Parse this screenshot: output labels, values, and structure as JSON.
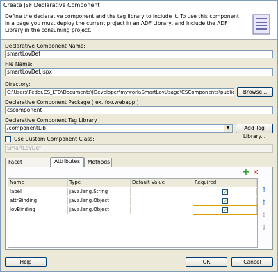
{
  "window": {
    "title": "Create JSF Declarative Component"
  },
  "banner": {
    "text": "Define the declarative component and the tag library to include it.  To use this component in a page you must deploy the current project in an ADF Library, and include the ADF Library in the consuming project."
  },
  "form": {
    "component_name_label": "Declarative Component Name:",
    "component_name_value": "smartLovDef",
    "file_name_label": "File Name:",
    "file_name_value": "smartLovDef.jspx",
    "directory_label": "Directory:",
    "directory_value": "C:\\Users\\Fedor.CS_LTD\\Documents\\JDeveloper\\mywork\\SmartLovUsage\\CSComponents\\public_html",
    "browse_label": "Browse...",
    "package_label": "Declarative Component Package ( ex. foo.webapp )",
    "package_value": "cscomponent",
    "taglib_label": "Declarative Component Tag Library",
    "taglib_value": "/componentLib",
    "add_taglib_label": "Add Tag Library...",
    "custom_class_label": "Use Custom Component Class:",
    "custom_class_value": "SmartLovDef"
  },
  "tabs": [
    "Facet Definitions",
    "Attributes",
    "Methods"
  ],
  "table": {
    "headers": [
      "Name",
      "Type",
      "Default Value",
      "Required"
    ],
    "rows": [
      {
        "name": "label",
        "type": "java.lang.String",
        "default": "",
        "required": true
      },
      {
        "name": "attrBinding",
        "type": "java.lang.Object",
        "default": "",
        "required": true
      },
      {
        "name": "lovBinding",
        "type": "java.lang.Object",
        "default": "",
        "required": true
      }
    ]
  },
  "footer": {
    "help_label": "Help",
    "ok_label": "OK",
    "cancel_label": "Cancel"
  },
  "colors": {
    "add": "#2e9e2e",
    "remove": "#d42a2a",
    "arrow": "#2f7ed8"
  }
}
